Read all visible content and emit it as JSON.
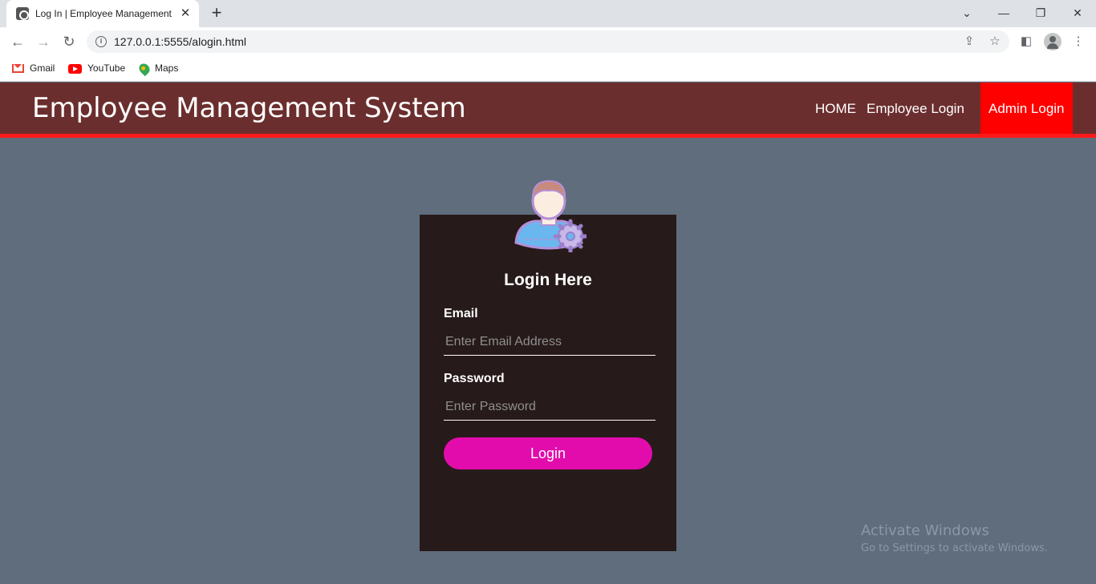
{
  "browser": {
    "tab_title": "Log In | Employee Management System",
    "url": "127.0.0.1:5555/alogin.html",
    "bookmarks": [
      "Gmail",
      "YouTube",
      "Maps"
    ]
  },
  "site": {
    "brand": "Employee Management System",
    "nav": {
      "home": "HOME",
      "employee_login": "Employee Login",
      "admin_login": "Admin Login"
    }
  },
  "login": {
    "title": "Login Here",
    "email_label": "Email",
    "email_placeholder": "Enter Email Address",
    "password_label": "Password",
    "password_placeholder": "Enter Password",
    "button_label": "Login"
  },
  "watermark": {
    "title": "Activate Windows",
    "subtitle": "Go to Settings to activate Windows."
  },
  "colors": {
    "header": "#6b2e2e",
    "accent_red": "#ff0000",
    "page_bg": "#5f6d7d",
    "card_bg": "#271a1a",
    "button": "#e20cac"
  }
}
